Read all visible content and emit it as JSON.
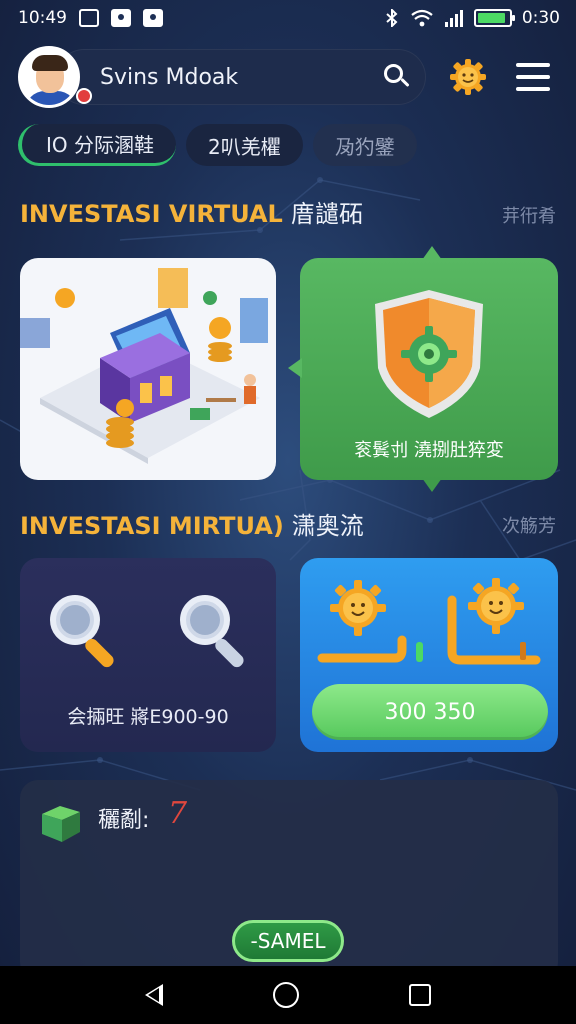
{
  "status_bar": {
    "time_left": "10:49",
    "time_right": "0:30",
    "battery_level": 0.9,
    "icons": [
      "image-icon",
      "camera-icon",
      "download-icon",
      "bluetooth-icon",
      "wifi-icon",
      "signal-icon",
      "battery-icon"
    ]
  },
  "header": {
    "username": "Svins Mdoak",
    "icons": [
      "avatar",
      "search-icon",
      "sun-gear-icon",
      "menu-icon"
    ]
  },
  "tabs": [
    {
      "label": "IO  分际溷鞋",
      "active": true
    },
    {
      "label": "2叭羌欋",
      "active": false
    },
    {
      "label": "夃犳鐾",
      "active": false
    }
  ],
  "section1": {
    "title": "INVESTASI VIRTUAL",
    "title_cjk": "庴譴砳",
    "right": "茾衎肴"
  },
  "shield_card": {
    "caption": "衮鬂刌  澆捌肚猝変"
  },
  "section2": {
    "title": "INVESTASI MIRTUA)",
    "title_cjk": "潇奥流",
    "right": "次觞芳"
  },
  "search_card": {
    "caption": "会掚旺  嶈E900-90"
  },
  "blue_card": {
    "amount": "300  350"
  },
  "bottom_card": {
    "label": "穲劀:",
    "value": "7",
    "button": "-SAMEL"
  },
  "colors": {
    "accent_orange": "#f5b33a",
    "green": "#4caf55",
    "blue": "#2f9df0",
    "red": "#e0473e",
    "background": "#1c2f55"
  }
}
